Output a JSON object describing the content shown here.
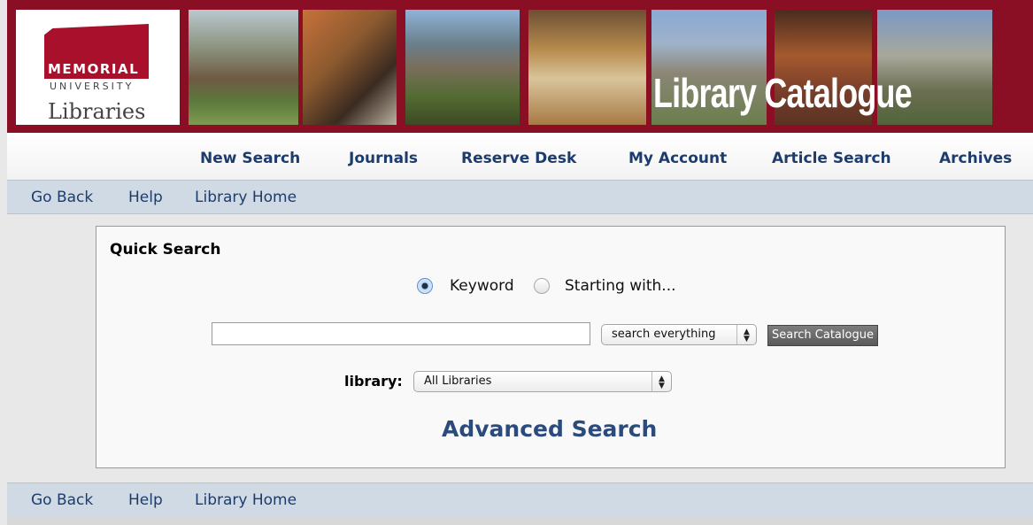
{
  "header": {
    "logo": {
      "line1": "MEMORIAL",
      "line2": "UNIVERSITY",
      "line3": "Libraries"
    },
    "banner_title": "Library Catalogue",
    "colors": {
      "banner": "#8b0f24",
      "logo_red": "#a8102b"
    }
  },
  "primary_nav": {
    "items": [
      {
        "label": "New Search"
      },
      {
        "label": "Journals"
      },
      {
        "label": "Reserve Desk"
      },
      {
        "label": "My Account"
      },
      {
        "label": "Article Search"
      },
      {
        "label": "Archives"
      }
    ]
  },
  "sub_nav": {
    "items": [
      {
        "label": "Go Back"
      },
      {
        "label": "Help"
      },
      {
        "label": "Library Home"
      }
    ]
  },
  "quick_search": {
    "title": "Quick Search",
    "radio_options": [
      {
        "label": "Keyword",
        "selected": true
      },
      {
        "label": "Starting with...",
        "selected": false
      }
    ],
    "query_value": "",
    "scope_select": {
      "selected": "search everything"
    },
    "search_button": "Search Catalogue",
    "library_label": "library:",
    "library_select": {
      "selected": "All Libraries"
    },
    "advanced_link": "Advanced Search"
  }
}
